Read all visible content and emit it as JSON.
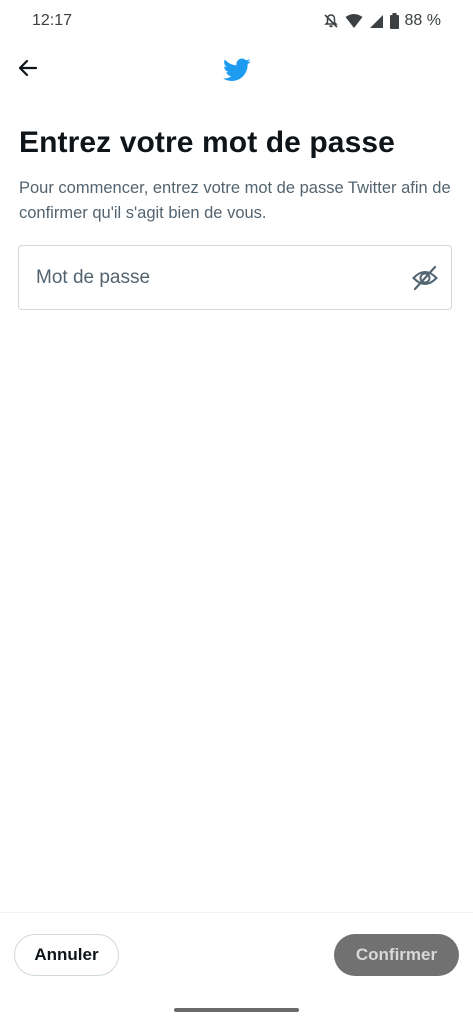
{
  "status_bar": {
    "time": "12:17",
    "battery": "88 %",
    "icons": [
      "notifications-off-icon",
      "wifi-icon",
      "cellular-signal-icon",
      "battery-icon"
    ]
  },
  "header": {
    "back_icon": "arrow-left-icon",
    "logo_icon": "twitter-bird-icon",
    "brand_color": "#1d9bf0"
  },
  "main": {
    "title": "Entrez votre mot de passe",
    "subtitle": "Pour commencer, entrez votre mot de passe Twitter afin de confirmer qu'il s'agit bien de vous.",
    "password_field": {
      "value": "",
      "placeholder": "Mot de passe",
      "toggle_icon": "eye-off-icon"
    }
  },
  "footer": {
    "cancel_label": "Annuler",
    "confirm_label": "Confirmer",
    "confirm_enabled": false
  }
}
